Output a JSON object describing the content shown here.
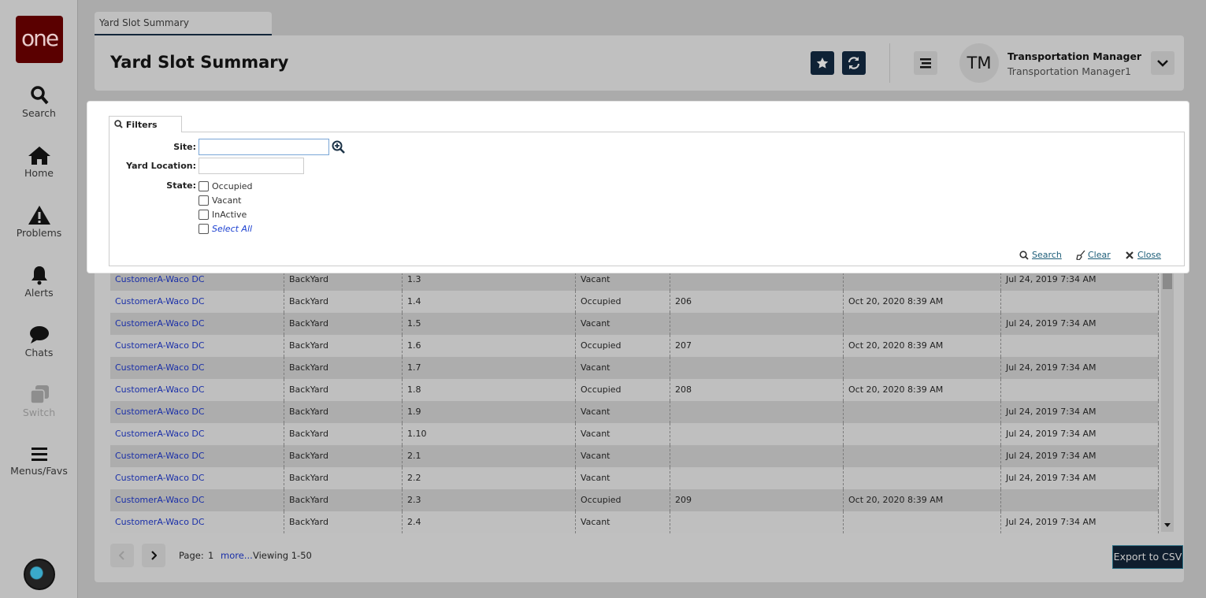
{
  "sidebar": {
    "logo": "one",
    "items": [
      {
        "label": "Search",
        "icon": "search-icon"
      },
      {
        "label": "Home",
        "icon": "home-icon"
      },
      {
        "label": "Problems",
        "icon": "warning-icon"
      },
      {
        "label": "Alerts",
        "icon": "bell-icon"
      },
      {
        "label": "Chats",
        "icon": "chat-icon"
      },
      {
        "label": "Switch",
        "icon": "switch-icon",
        "disabled": true
      },
      {
        "label": "Menus/Favs",
        "icon": "menu-icon"
      }
    ]
  },
  "tab": {
    "label": "Yard Slot Summary"
  },
  "header": {
    "title": "Yard Slot Summary",
    "user_initials": "TM",
    "user_name": "Transportation Manager",
    "user_role": "Transportation Manager1"
  },
  "filters": {
    "tab_label": "Filters",
    "site_label": "Site:",
    "site_value": "",
    "yard_location_label": "Yard Location:",
    "yard_location_value": "",
    "state_label": "State:",
    "states": [
      "Occupied",
      "Vacant",
      "InActive"
    ],
    "select_all": "Select All",
    "search": "Search",
    "clear": "Clear",
    "close": "Close"
  },
  "table": {
    "rows": [
      [
        "CustomerA-Waco DC",
        "BackYard",
        "1.3",
        "Vacant",
        "",
        "",
        "Jul 24, 2019 7:34 AM"
      ],
      [
        "CustomerA-Waco DC",
        "BackYard",
        "1.4",
        "Occupied",
        "206",
        "Oct 20, 2020 8:39 AM",
        ""
      ],
      [
        "CustomerA-Waco DC",
        "BackYard",
        "1.5",
        "Vacant",
        "",
        "",
        "Jul 24, 2019 7:34 AM"
      ],
      [
        "CustomerA-Waco DC",
        "BackYard",
        "1.6",
        "Occupied",
        "207",
        "Oct 20, 2020 8:39 AM",
        ""
      ],
      [
        "CustomerA-Waco DC",
        "BackYard",
        "1.7",
        "Vacant",
        "",
        "",
        "Jul 24, 2019 7:34 AM"
      ],
      [
        "CustomerA-Waco DC",
        "BackYard",
        "1.8",
        "Occupied",
        "208",
        "Oct 20, 2020 8:39 AM",
        ""
      ],
      [
        "CustomerA-Waco DC",
        "BackYard",
        "1.9",
        "Vacant",
        "",
        "",
        "Jul 24, 2019 7:34 AM"
      ],
      [
        "CustomerA-Waco DC",
        "BackYard",
        "1.10",
        "Vacant",
        "",
        "",
        "Jul 24, 2019 7:34 AM"
      ],
      [
        "CustomerA-Waco DC",
        "BackYard",
        "2.1",
        "Vacant",
        "",
        "",
        "Jul 24, 2019 7:34 AM"
      ],
      [
        "CustomerA-Waco DC",
        "BackYard",
        "2.2",
        "Vacant",
        "",
        "",
        "Jul 24, 2019 7:34 AM"
      ],
      [
        "CustomerA-Waco DC",
        "BackYard",
        "2.3",
        "Occupied",
        "209",
        "Oct 20, 2020 8:39 AM",
        ""
      ],
      [
        "CustomerA-Waco DC",
        "BackYard",
        "2.4",
        "Vacant",
        "",
        "",
        "Jul 24, 2019 7:34 AM"
      ]
    ]
  },
  "pagination": {
    "page_label": "Page:",
    "page": "1",
    "more": "more...",
    "viewing": "Viewing 1-50"
  },
  "export_label": "Export to CSV",
  "colors": {
    "accent": "#0f2236",
    "logo": "#5a0000",
    "link": "#1a2fa8"
  }
}
